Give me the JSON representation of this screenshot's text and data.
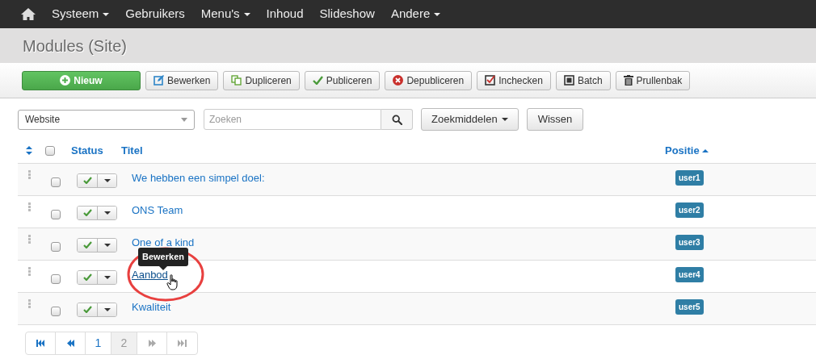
{
  "navbar": {
    "items": [
      {
        "label": "Systeem",
        "dropdown": true
      },
      {
        "label": "Gebruikers",
        "dropdown": false
      },
      {
        "label": "Menu's",
        "dropdown": true
      },
      {
        "label": "Inhoud",
        "dropdown": false
      },
      {
        "label": "Slideshow",
        "dropdown": false
      },
      {
        "label": "Andere",
        "dropdown": true
      }
    ]
  },
  "page_title": "Modules (Site)",
  "toolbar": [
    {
      "label": "Nieuw",
      "kind": "primary"
    },
    {
      "label": "Bewerken",
      "kind": "default"
    },
    {
      "label": "Dupliceren",
      "kind": "default"
    },
    {
      "label": "Publiceren",
      "kind": "default"
    },
    {
      "label": "Depubliceren",
      "kind": "default"
    },
    {
      "label": "Inchecken",
      "kind": "default"
    },
    {
      "label": "Batch",
      "kind": "default"
    },
    {
      "label": "Prullenbak",
      "kind": "default"
    }
  ],
  "filters": {
    "site_select": "Website",
    "search": {
      "placeholder": "Zoeken"
    },
    "tools_button": "Zoekmiddelen",
    "clear_button": "Wissen"
  },
  "table": {
    "columns": {
      "status": "Status",
      "title": "Titel",
      "position": "Positie"
    },
    "select_all_checked": false,
    "rows": [
      {
        "title": "We hebben een simpel doel:",
        "position": "user1",
        "published": true,
        "checked": false,
        "hovered": false
      },
      {
        "title": "ONS Team",
        "position": "user2",
        "published": true,
        "checked": false,
        "hovered": false
      },
      {
        "title": "One of a kind",
        "position": "user3",
        "published": true,
        "checked": false,
        "hovered": false
      },
      {
        "title": "Aanbod",
        "position": "user4",
        "published": true,
        "checked": false,
        "hovered": true
      },
      {
        "title": "Kwaliteit",
        "position": "user5",
        "published": true,
        "checked": false,
        "hovered": false
      }
    ]
  },
  "tooltip": {
    "text": "Bewerken"
  },
  "pagination": {
    "pages": [
      {
        "label": "1",
        "selected": false
      },
      {
        "label": "2",
        "selected": true
      }
    ]
  }
}
